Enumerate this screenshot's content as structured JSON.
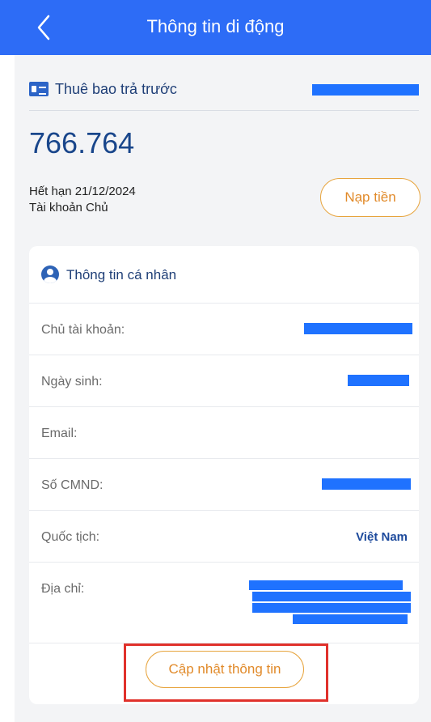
{
  "header": {
    "title": "Thông tin di động",
    "back_icon": "chevron-left-icon"
  },
  "subscription": {
    "label": "Thuê bao trả trước",
    "icon": "id-card-icon",
    "balance": "766.764",
    "expiry": "Hết hạn 21/12/2024",
    "account_type": "Tài khoản Chủ",
    "topup_label": "Nạp tiền"
  },
  "personal_info": {
    "title": "Thông tin cá nhân",
    "icon": "user-circle-icon",
    "rows": [
      {
        "label": "Chủ tài khoản:",
        "value": ""
      },
      {
        "label": "Ngày sinh:",
        "value": ""
      },
      {
        "label": "Email:",
        "value": ""
      },
      {
        "label": "Số CMND:",
        "value": ""
      },
      {
        "label": "Quốc tịch:",
        "value": "Việt Nam"
      },
      {
        "label": "Địa chỉ:",
        "value": ""
      }
    ],
    "update_label": "Cập nhật thông tin"
  },
  "colors": {
    "header_blue": "#2d6cf6",
    "accent_orange": "#e7a43d",
    "highlight_red": "#e0312b",
    "redaction_blue": "#1f72ff"
  }
}
